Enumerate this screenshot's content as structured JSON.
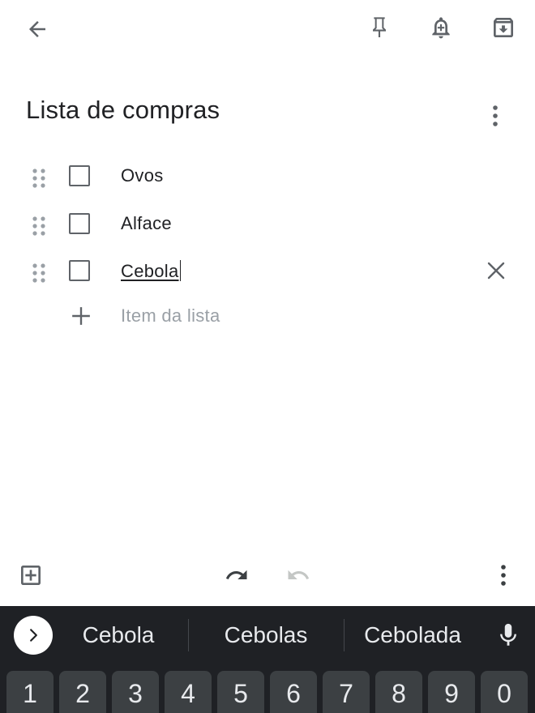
{
  "note": {
    "title": "Lista de compras",
    "items": [
      {
        "label": "Ovos",
        "checked": false
      },
      {
        "label": "Alface",
        "checked": false
      },
      {
        "label": "Cebola",
        "checked": false,
        "editing": true
      }
    ],
    "add_item_placeholder": "Item da lista"
  },
  "toolbar_top": {
    "icons": [
      "back-arrow-icon",
      "pin-icon",
      "reminder-bell-icon",
      "archive-icon"
    ]
  },
  "toolbar_bottom": {
    "icons": [
      "add-box-icon",
      "undo-icon",
      "redo-icon",
      "more-vert-icon"
    ]
  },
  "keyboard": {
    "suggestions": [
      "Cebola",
      "Cebolas",
      "Cebolada"
    ],
    "number_keys": [
      "1",
      "2",
      "3",
      "4",
      "5",
      "6",
      "7",
      "8",
      "9",
      "0"
    ]
  },
  "colors": {
    "icon": "#5f6368",
    "text": "#202124",
    "placeholder": "#9aa0a6",
    "keyboard_bg": "#1f2125",
    "key_bg": "#3c4043"
  }
}
